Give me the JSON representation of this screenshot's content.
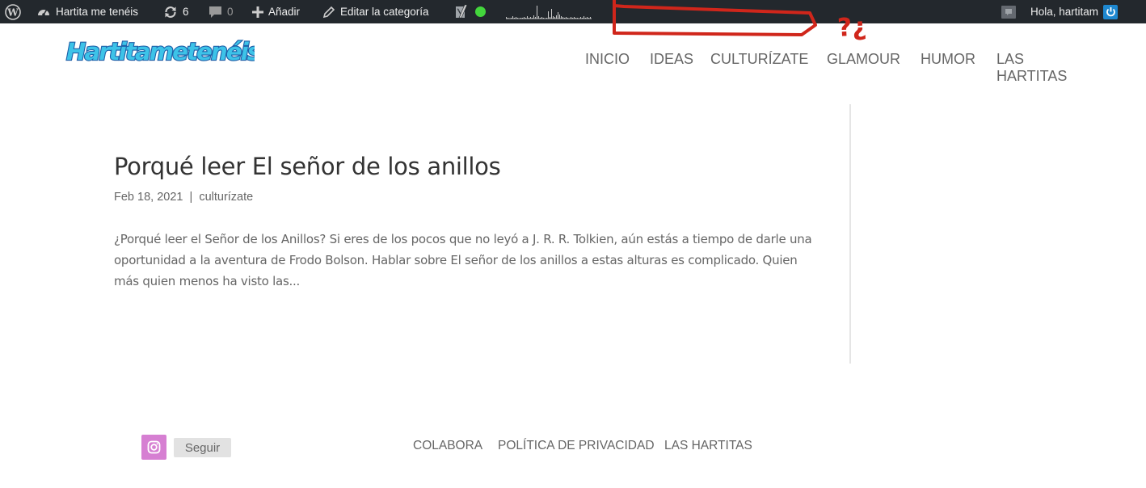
{
  "admin_bar": {
    "site_name": "Hartita me tenéis",
    "updates_count": "6",
    "comments_count": "0",
    "new_label": "Añadir",
    "edit_label": "Editar la categoría",
    "greeting": "Hola, hartitam"
  },
  "annotation": {
    "text": "?¿",
    "color": "#d0261b"
  },
  "header": {
    "logo_text": "Hartitametenéis",
    "nav": [
      "INICIO",
      "IDEAS",
      "CULTURÍZATE",
      "GLAMOUR",
      "HUMOR",
      "LAS HARTITAS"
    ]
  },
  "post": {
    "title": "Porqué leer El señor de los anillos",
    "date": "Feb 18, 2021",
    "separator": "|",
    "category": "culturízate",
    "excerpt": "¿Porqué leer el Señor de los Anillos? Si eres de los pocos que no leyó a J. R. R. Tolkien, aún estás a tiempo de darle una oportunidad a la aventura de Frodo Bolson. Hablar sobre El señor de los anillos a estas alturas es complicado. Quien más quien menos ha visto las..."
  },
  "footer": {
    "follow_label": "Seguir",
    "links": [
      "COLABORA",
      "POLÍTICA DE PRIVACIDAD",
      "LAS HARTITAS"
    ]
  },
  "colors": {
    "admin_bar_bg": "#23282d",
    "instagram": "#d67fd2",
    "status_dot": "#43d63c",
    "logo_fill": "#3dc3e8",
    "logo_outline": "#1e5fa8"
  }
}
